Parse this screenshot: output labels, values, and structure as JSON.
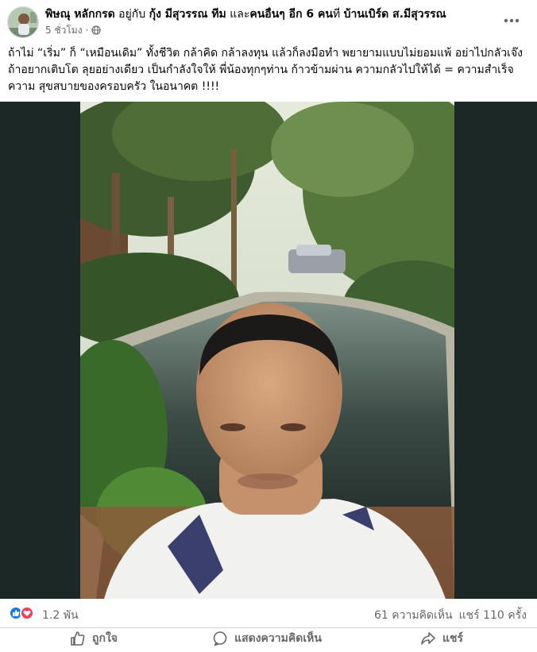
{
  "post": {
    "author": "พิษณุ หลักกรด",
    "with_prefix": "อยู่กับ",
    "tagged": "กุ้ง มีสุวรรณ ทีม",
    "and_word": "และ",
    "others": "คนอื่นๆ อีก 6 คน",
    "at_word": "ที่",
    "location": "บ้านเบิร์ด ส.มีสุวรรณ",
    "time": "5 ชั่วโมง",
    "separator": "·",
    "privacy_icon": "globe-icon",
    "text": "ถ้าไม่ “เริ่ม” ก็ “เหมือนเดิม” ทั้งชีวิต  กล้าคิด กล้าลงทุน แล้วก็ลงมือทำ พยายามแบบไม่ยอมแพ้  อย่าไปกลัวเจ๊ง ถ้าอยากเติบโต ลุยอย่างเดียว เป็นกำลังใจให้ พี่น้องทุกๆท่าน ก้าวข้ามผ่าน ความกลัวไปให้ได้  =  ความสำเร็จ ความ สุขสบายของครอบครัว ในอนาคต !!!!"
  },
  "reactions": {
    "count": "1.2 พัน",
    "icons": [
      "like-icon",
      "love-icon"
    ],
    "comments": "61 ความคิดเห็น",
    "shares": "แชร์ 110 ครั้ง"
  },
  "actions": {
    "like_label": "ถูกใจ",
    "comment_label": "แสดงความคิดเห็น",
    "share_label": "แชร์"
  },
  "colors": {
    "like_blue": "#1877f2",
    "love_red": "#f33e58",
    "secondary_text": "#65676b",
    "media_background": "#1b2825"
  }
}
